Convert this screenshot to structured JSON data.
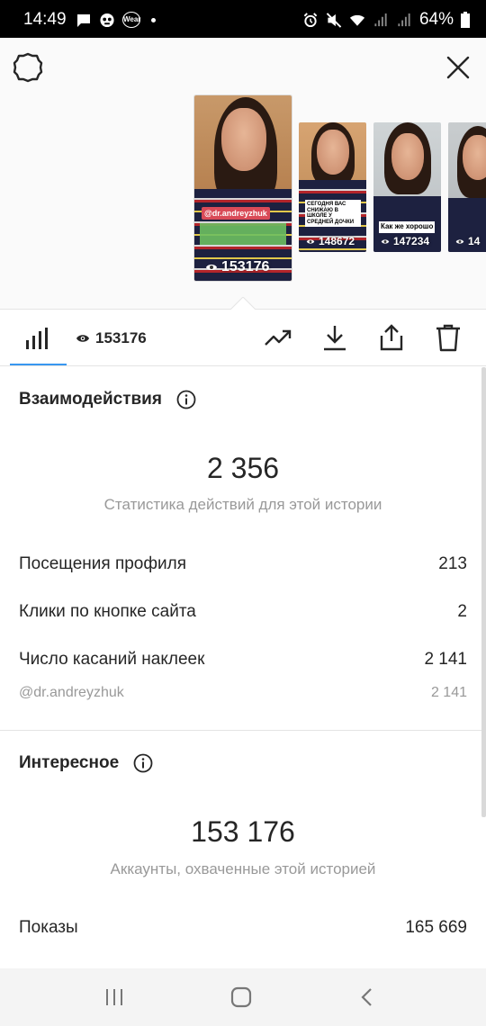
{
  "status_bar": {
    "time": "14:49",
    "battery": "64%",
    "wear_label": "Wear"
  },
  "stories": [
    {
      "views": "153176",
      "tag": "@dr.andreyzhuk",
      "selected": true
    },
    {
      "views": "148672",
      "caption": "СЕГОДНЯ ВАС СНИЖАЮ В ШКОЛЕ У СРЕДНЕЙ ДОЧКИ"
    },
    {
      "views": "147234",
      "caption": "Как же хорошо"
    },
    {
      "views": "14"
    }
  ],
  "toolbar": {
    "views": "153176"
  },
  "interactions": {
    "title": "Взаимодействия",
    "total": "2 356",
    "caption": "Статистика действий для этой истории",
    "rows": [
      {
        "label": "Посещения профиля",
        "value": "213"
      },
      {
        "label": "Клики по кнопке сайта",
        "value": "2"
      },
      {
        "label": "Число касаний наклеек",
        "value": "2 141"
      }
    ],
    "sub_row": {
      "label": "@dr.andreyzhuk",
      "value": "2 141"
    }
  },
  "discovery": {
    "title": "Интересное",
    "total": "153 176",
    "caption": "Аккаунты, охваченные этой историей",
    "rows": [
      {
        "label": "Показы",
        "value": "165 669"
      }
    ]
  },
  "colors": {
    "accent": "#3897f0",
    "text": "#262626",
    "muted": "#999999"
  }
}
